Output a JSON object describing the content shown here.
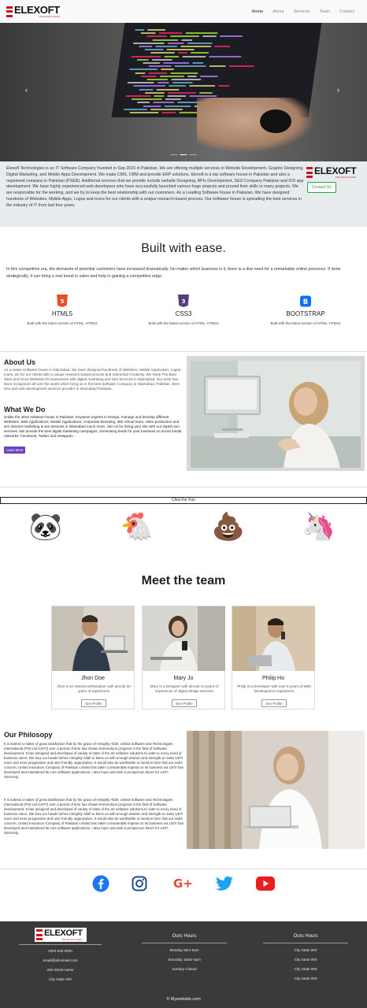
{
  "brand": {
    "name": "ELEXOFT",
    "tagline": "TECHNOLOGIES"
  },
  "nav": {
    "items": [
      {
        "label": "Home"
      },
      {
        "label": "About"
      },
      {
        "label": "Services"
      },
      {
        "label": "Team"
      },
      {
        "label": "Contact"
      }
    ]
  },
  "hero": {
    "prev_icon": "chevron-left-icon",
    "next_icon": "chevron-right-icon",
    "slides": 3,
    "active_slide": 2
  },
  "intro": {
    "text": "Elexoft Technologies is an IT Software Company founded in Sep 2015 in Pakistan. We are offering multiple services in Website Development, Graphic Designing, Digital Marketing, and Mobile Apps Development. We make CMS, CRM and provide ERP solutions. Elexoft is a top software house in Pakistan and also a registered company in Pakistan (PSEB). Additional services that we provide include website Designing, APIs Development, SEO Company Pakistan and iOS app development. We have highly experienced web developers who have successfully launched various huge projects and proved their skills in many projects. We are responsible for the working, and we try to keep the best relationship with our customers. As a Leading Software house in Pakistan, We have designed hundreds of Websites, Mobile Apps, Logos and Icons for our clients with a unique research-based process. Our software house is spreading the best services in the industry of IT from last four years.",
    "contact_button": "Contact Us"
  },
  "built": {
    "title": "Built with ease.",
    "text": "In this competitive era, the demands of potential customers have increased dramatically. No matter which business is it, there is a dire need for a remarkable online presence. If done strategically, it can bring a real boost in sales and help in gaining a competitive edge.",
    "techs": [
      {
        "name": "HTML5",
        "desc": "Built with the latest version of HTML, HTML5",
        "icon": "html5-icon",
        "color": "#e34f26"
      },
      {
        "name": "CSS3",
        "desc": "Built with the latest version of HTML, HTML5",
        "icon": "css3-icon",
        "color": "#563d7c"
      },
      {
        "name": "BOOTSTRAP",
        "desc": "Built with the latest version of HTML, HTML5",
        "icon": "bootstrap-icon",
        "color": "#0d6efd"
      }
    ]
  },
  "about": {
    "title": "About Us",
    "text": "As a native Software house in Islamabad. We have designed hundreds of Websites, Mobile Application, Logos, Icons, etc for our clients with a unique research-based process and Inferential Creativity. We Rank The Best Sites and Grow Websites for businesses with digital marketing and Seo Services in Islamabad. Our work has been recognized all over the world which bring us in the best Software Company in Islamabad, Pakistan. Best Seo and web development services provider in Islamabad Pakistan.",
    "wwd_title": "What We Do",
    "wwd_text": "Unlike the other software house in Pakistan, Keyweve experts in Design, manage and develop different Websites, Web Applications, Mobile Applications, Corporate Branding, 360 Virtual tours, video production and seo internet marketing & seo services in islamabad much more. Join us for hiring your site with our expert seo services. We provide the best digital marketing campaigns. Generating leads for your business on social media networks: Facebook, Twitter and Instagram.",
    "learn_button": "Learn More"
  },
  "fun": {
    "label": "Click For Fun",
    "emojis": [
      "🐼",
      "🐔",
      "💩",
      "🦄"
    ]
  },
  "team": {
    "title": "Meet the team",
    "members": [
      {
        "name": "Jhon Doe",
        "desc": "Jhon is an Internet philosopher with almost 20 years of experience",
        "button": "See Profile"
      },
      {
        "name": "Mary Jo",
        "desc": "Mary is a Designer with almost 10 years of experience of digital design services",
        "button": "See Profile"
      },
      {
        "name": "Philip Ho",
        "desc": "Philip is a Developer with over 5 years of Web Development experience",
        "button": "See Profile"
      }
    ]
  },
  "philosophy": {
    "title": "Our Philosopy",
    "paragraphs": [
      "It is indeed a matter of great satisfaction that by the grace of Almighty Allah, United Software and Technologies International (Pvt) Ltd (USTI) over a period of time has shown tremendous progress in the field of Software development. It has designed and developed of variety of state of the art software solutions to cater to every need of business users. We bow our heads before Almighty Allah to bless us with enough wisdom and strength to make USTI more and more progressive and user friendly organization. It would also be worthwhile to mention here that our sister concern, United Insurance Company of Pakistan Limited has taken considerable impetus to its business via USTI has developed and maintained its core software applications. I also hope and wish a prosperous future for USTI. Sincerely,",
      "It is indeed a matter of great satisfaction that by the grace of Almighty Allah, United Software and Technologies International (Pvt) Ltd (USTI) over a period of time has shown tremendous progress in the field of Software development. It has designed and developed of variety of state of the art software solutions to cater to every need of business users. We bow our heads before Almighty Allah to bless us with enough wisdom and strength to make USTI more and more progressive and user friendly organization. It would also be worthwhile to mention here that our sister concern, United Insurance Company of Pakistan Limited has taken considerable impetus to its business via USTI has developed and maintained its core software applications. I also hope and wish a prosperous future for USTI. Sincerely,"
    ]
  },
  "social": [
    {
      "name": "facebook-icon",
      "color": "#1877f2"
    },
    {
      "name": "instagram-icon",
      "color": "#1f4e8c"
    },
    {
      "name": "google-plus-icon",
      "color": "#dd4b39"
    },
    {
      "name": "twitter-icon",
      "color": "#1da1f2"
    },
    {
      "name": "youtube-icon",
      "color": "#ee1d1d"
    }
  ],
  "footer": {
    "contact": [
      "0300 000 0000",
      "email@abcemail.com",
      "000 Street name",
      "City State 000"
    ],
    "hours_title": "Ours Hours",
    "hours": [
      "Monday 9am-5am",
      "Saturday 10am-4pm",
      "Sunday Closed"
    ],
    "hours2_title": "Ours Hours",
    "hours2": [
      "City State 000",
      "City State 000",
      "City State 000",
      "City State 000"
    ],
    "copyright": "© Mywebsite.com"
  }
}
